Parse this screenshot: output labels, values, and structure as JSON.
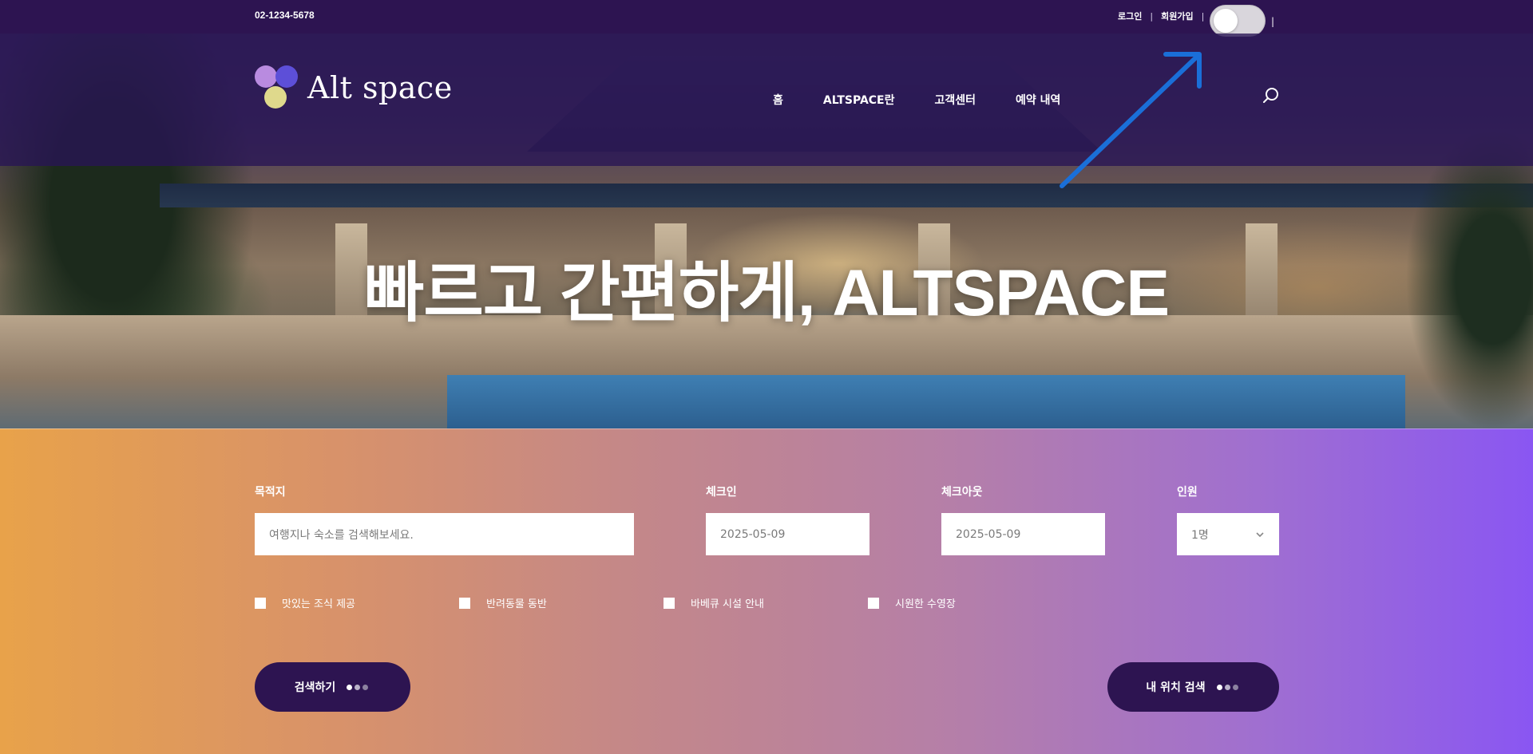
{
  "topbar": {
    "phone": "02-1234-5678",
    "login": "로그인",
    "signup": "회원가입",
    "separator": "|"
  },
  "header": {
    "logo_text": "Alt space",
    "nav": [
      "홈",
      "ALTSPACE란",
      "고객센터",
      "예약 내역"
    ]
  },
  "hero": {
    "headline": "빠르고 간편하게, ALTSPACE"
  },
  "search": {
    "destination_label": "목적지",
    "destination_placeholder": "여행지나 숙소를 검색해보세요.",
    "checkin_label": "체크인",
    "checkin_value": "2025-05-09",
    "checkout_label": "체크아웃",
    "checkout_value": "2025-05-09",
    "guests_label": "인원",
    "guests_value": "1명",
    "options": [
      "맛있는 조식 제공",
      "반려동물 동반",
      "바베큐 시설 안내",
      "시원한 수영장"
    ],
    "search_button": "검색하기",
    "location_button": "내 위치 검색"
  },
  "colors": {
    "brand_dark": "#2d1451",
    "gradient_start": "#e8a24a",
    "gradient_end": "#8a56f2",
    "annotation_arrow": "#1a6fd8"
  },
  "toggle": {
    "on": false
  }
}
